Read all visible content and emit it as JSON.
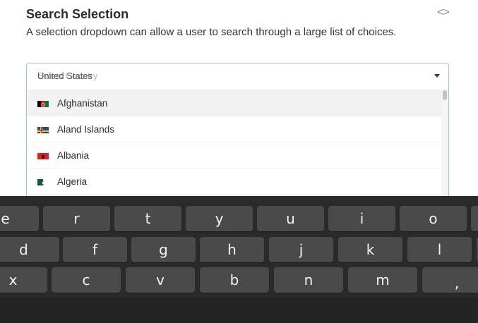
{
  "header": {
    "title": "Search Selection",
    "code_icon": "code-toggle-icon",
    "code_glyph": "<>",
    "subtitle": "A selection dropdown can allow a user to search through a large list of choices."
  },
  "dropdown": {
    "placeholder": "Select Country",
    "selected_value": "United States",
    "caret_icon": "caret-down-icon",
    "options": [
      {
        "label": "Afghanistan",
        "flag": "af-flag-icon"
      },
      {
        "label": "Aland Islands",
        "flag": "ax-flag-icon"
      },
      {
        "label": "Albania",
        "flag": "al-flag-icon"
      },
      {
        "label": "Algeria",
        "flag": "dz-flag-icon"
      },
      {
        "label": "",
        "flag": ""
      }
    ]
  },
  "keyboard": {
    "row1": [
      "e",
      "r",
      "t",
      "y",
      "u",
      "i",
      "o"
    ],
    "row2": [
      "d",
      "f",
      "g",
      "h",
      "j",
      "k",
      "l"
    ],
    "row3": [
      "x",
      "c",
      "v",
      "b",
      "n",
      "m",
      ","
    ]
  },
  "colors": {
    "focus_border": "#96c8da",
    "key_bg": "#4a4a4a",
    "keyboard_bg": "#2a2a2a"
  }
}
